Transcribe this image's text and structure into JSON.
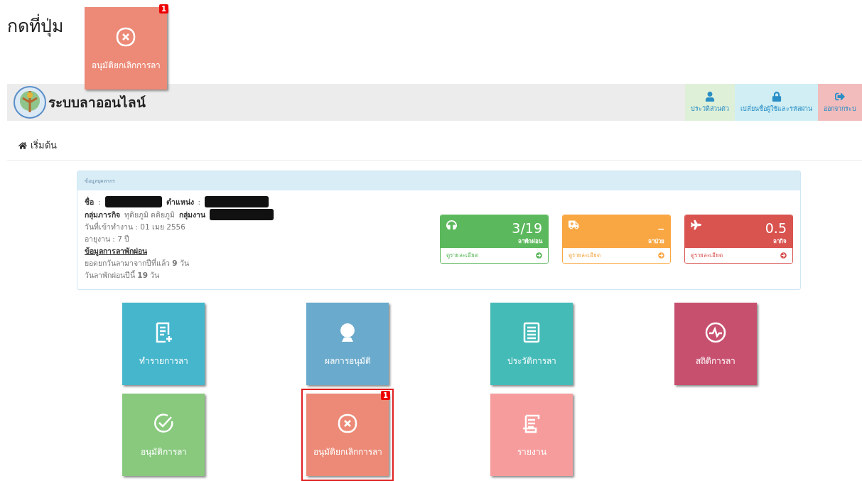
{
  "instruction": "กดที่ปุ่ม",
  "preview_tile": {
    "label": "อนุมัติยกเลิกการลา",
    "kind": "cancel",
    "color": "#ec8a77",
    "badge": "1"
  },
  "header": {
    "title": "ระบบลาออนไลน์",
    "nav": [
      {
        "label": "ประวัติส่วนตัว",
        "kind": "user",
        "color": "#dff0d8"
      },
      {
        "label": "เปลี่ยนชื่อผู้ใช้และรหัสผ่าน",
        "kind": "lock",
        "color": "#d0eef3"
      },
      {
        "label": "ออกจากระบ",
        "kind": "logout",
        "color": "#f2bcbc"
      }
    ]
  },
  "breadcrumb": "เริ่มต้น",
  "panel": {
    "title": "ข้อมูลบุคลากร",
    "lines": [
      {
        "kind": "pair",
        "parts": [
          {
            "label": "ชื่อ",
            "sep": ":",
            "redacted": true
          },
          {
            "label": "ตำแหน่ง",
            "sep": ":",
            "redacted": true
          }
        ]
      },
      {
        "kind": "pair",
        "parts": [
          {
            "label": "กลุ่มภารกิจ",
            "value": "ทุติยภูมิ ตติยภูมิ"
          },
          {
            "label": "กลุ่มงาน",
            "redacted": true
          }
        ]
      },
      {
        "kind": "text",
        "text": "วันที่เข้าทำงาน : 01 เมย 2556"
      },
      {
        "kind": "text",
        "text": "อายุงาน : 7  ปี"
      },
      {
        "kind": "heading",
        "text": "ข้อมูลการลาพักผ่อน"
      },
      {
        "kind": "text",
        "text": "ยอดยกวันลามาจากปีที่แล้ว **9** วัน"
      },
      {
        "kind": "text",
        "text": "วันลาพักผ่อนปีนี้ **19** วัน"
      }
    ],
    "stats": [
      {
        "kind": "headphones",
        "value": "3/19",
        "label": "ลาพักผ่อน",
        "link": "ดูรายละเอียด",
        "color": "#5cb85c"
      },
      {
        "kind": "ambulance",
        "value": "–",
        "label": "ลาป่วย",
        "link": "ดูรายละเอียด",
        "color": "#f9a743"
      },
      {
        "kind": "plane",
        "value": "0.5",
        "label": "ลากิจ",
        "link": "ดูรายละเอียด",
        "color": "#d9534f"
      }
    ]
  },
  "tiles": [
    {
      "label": "ทำรายการลา",
      "kind": "doc-plus",
      "color": "#45b6cc",
      "highlighted": false
    },
    {
      "label": "ผลการอนุมัติ",
      "kind": "webcam",
      "color": "#6aaacc",
      "highlighted": false
    },
    {
      "label": "ประวัติการลา",
      "kind": "list",
      "color": "#45bbb8",
      "highlighted": false
    },
    {
      "label": "สถิติการลา",
      "kind": "pulse",
      "color": "#c8506f",
      "highlighted": false
    },
    {
      "label": "อนุมัติการลา",
      "kind": "check",
      "color": "#88c97e",
      "highlighted": false
    },
    {
      "label": "อนุมัติยกเลิกการลา",
      "kind": "cancel",
      "color": "#ec8a77",
      "highlighted": true,
      "badge": "1"
    },
    {
      "label": "รายงาน",
      "kind": "scroll",
      "color": "#f79c9c",
      "highlighted": false
    }
  ]
}
